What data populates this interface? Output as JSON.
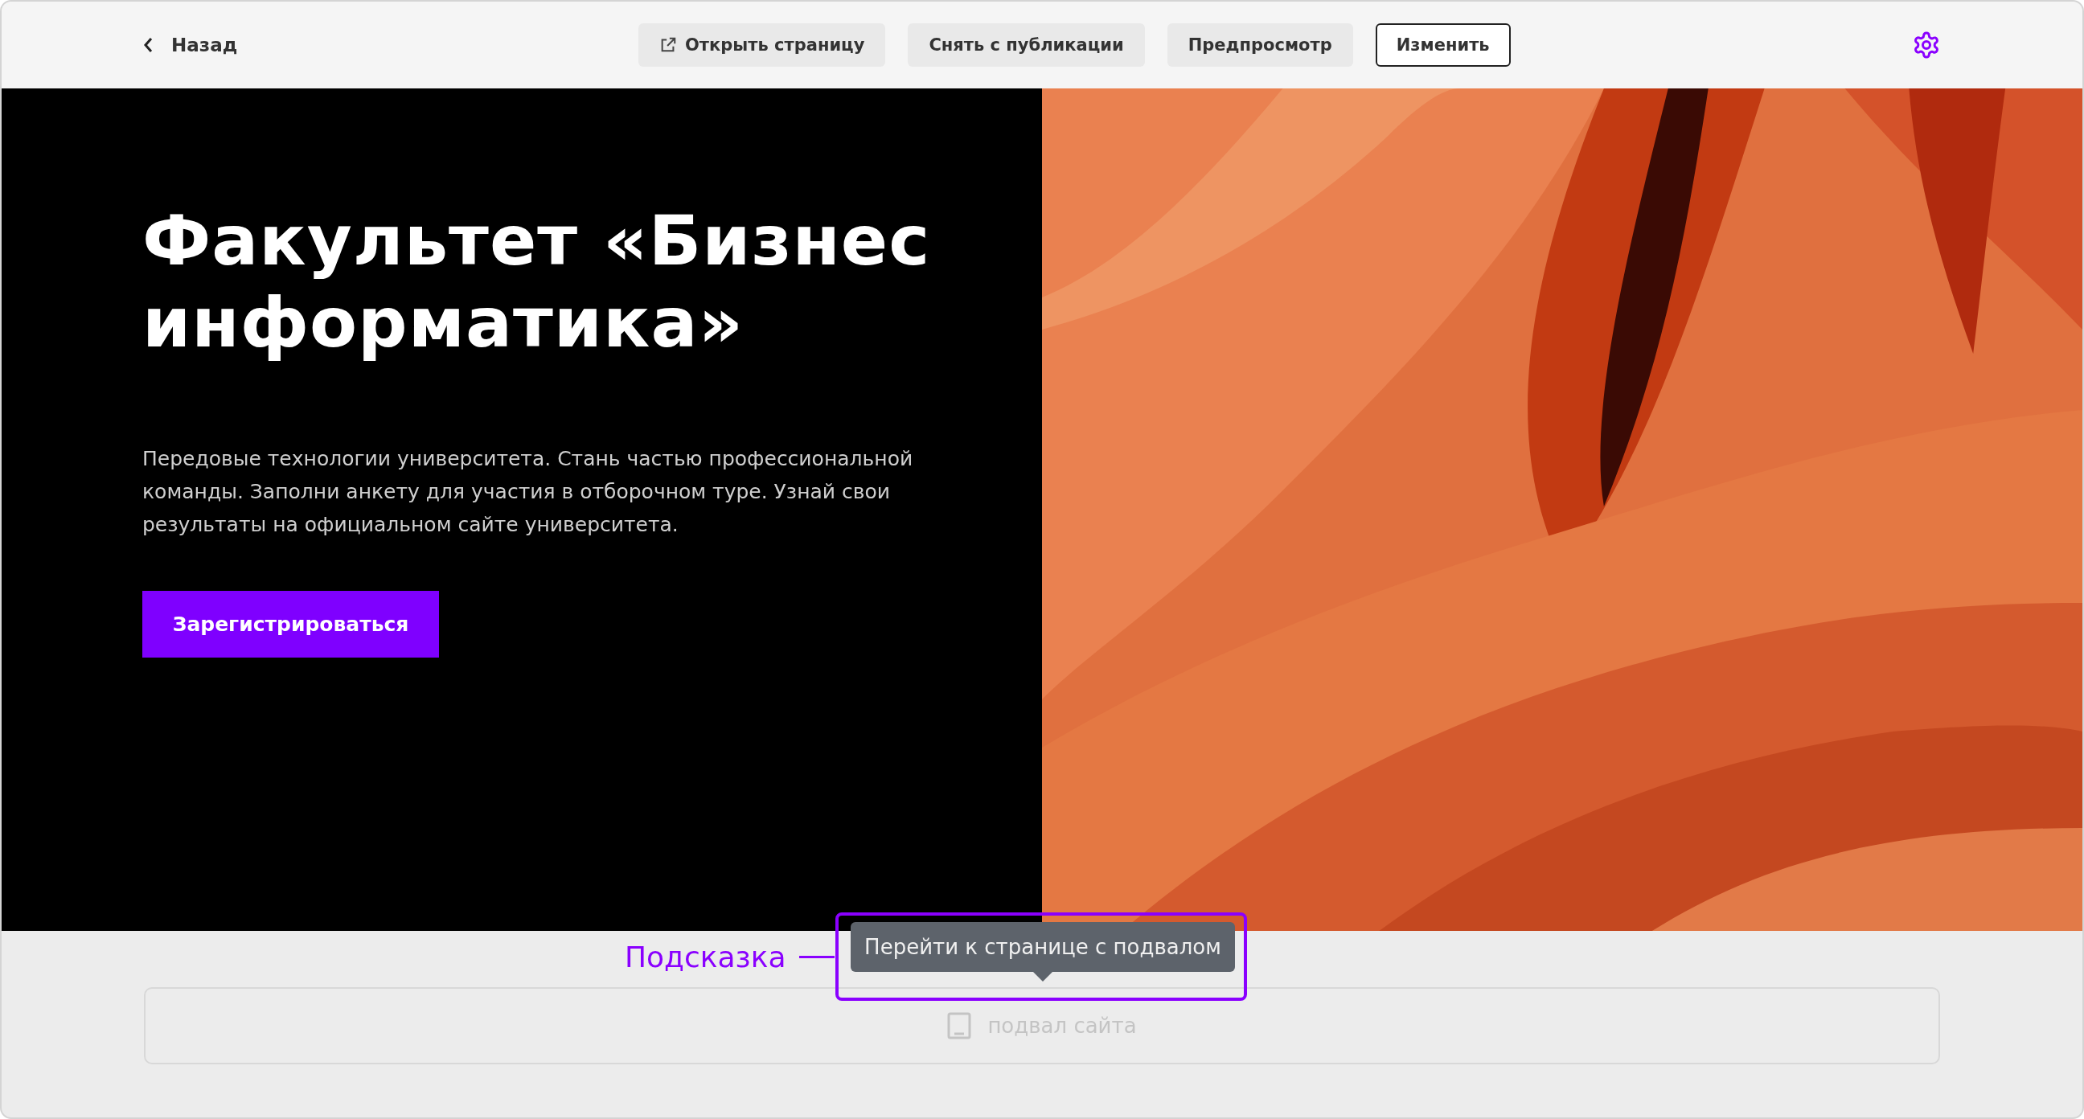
{
  "topbar": {
    "back": {
      "label": "Назад"
    },
    "actions": [
      {
        "label": "Открыть страницу",
        "kind": "external"
      },
      {
        "label": "Снять с публикации",
        "kind": "plain"
      },
      {
        "label": "Предпросмотр",
        "kind": "plain"
      },
      {
        "label": "Изменить",
        "kind": "outlined"
      }
    ]
  },
  "hero": {
    "title": "Факультет «Бизнес информатика»",
    "description": "Передовые технологии университета. Стань частью профессиональной команды. Заполни анкету для участия в отборочном туре. Узнай свои результаты на официальном сайте университета.",
    "cta": "Зарегистрироваться"
  },
  "footer_slot": {
    "label": "подвал сайта"
  },
  "tooltip": {
    "text": "Перейти к странице с подвалом"
  },
  "annotation": {
    "label": "Подсказка"
  }
}
